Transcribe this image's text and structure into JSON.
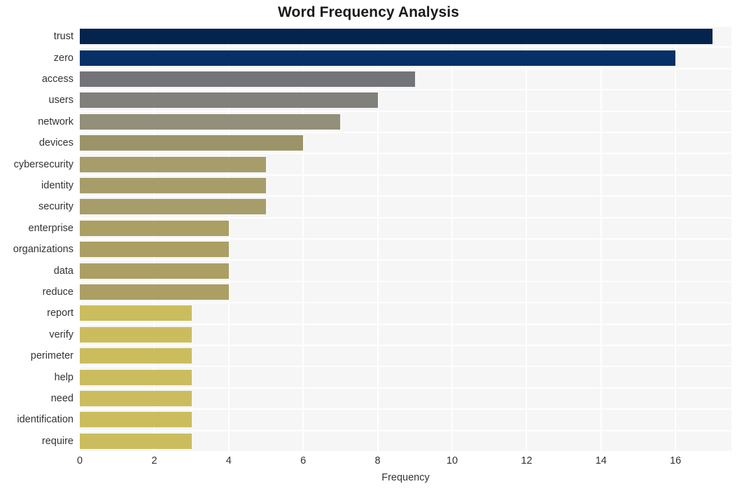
{
  "chart_data": {
    "type": "bar",
    "orientation": "horizontal",
    "title": "Word Frequency Analysis",
    "xlabel": "Frequency",
    "ylabel": "",
    "categories": [
      "trust",
      "zero",
      "access",
      "users",
      "network",
      "devices",
      "cybersecurity",
      "identity",
      "security",
      "enterprise",
      "organizations",
      "data",
      "reduce",
      "report",
      "verify",
      "perimeter",
      "help",
      "need",
      "identification",
      "require"
    ],
    "values": [
      17,
      16,
      9,
      8,
      7,
      6,
      5,
      5,
      5,
      4,
      4,
      4,
      4,
      3,
      3,
      3,
      3,
      3,
      3,
      3
    ],
    "bar_colors": [
      "#04244e",
      "#063167",
      "#73747a",
      "#81807b",
      "#928f7a",
      "#9b9468",
      "#a79d6b",
      "#a79d6b",
      "#a79d6b",
      "#ab9f63",
      "#ab9f63",
      "#ab9f63",
      "#ab9f63",
      "#cbbd5e",
      "#cbbd5e",
      "#cbbd5e",
      "#cbbd5e",
      "#cbbd5e",
      "#cbbd5e",
      "#cbbd5e"
    ],
    "xticks": [
      0,
      2,
      4,
      6,
      8,
      10,
      12,
      14,
      16
    ],
    "xlim": [
      0,
      17.5
    ],
    "grid": true,
    "grid_color": "#ffffff",
    "plot_background": "#f6f6f6",
    "figure_background": "#ffffff",
    "legend": null
  }
}
